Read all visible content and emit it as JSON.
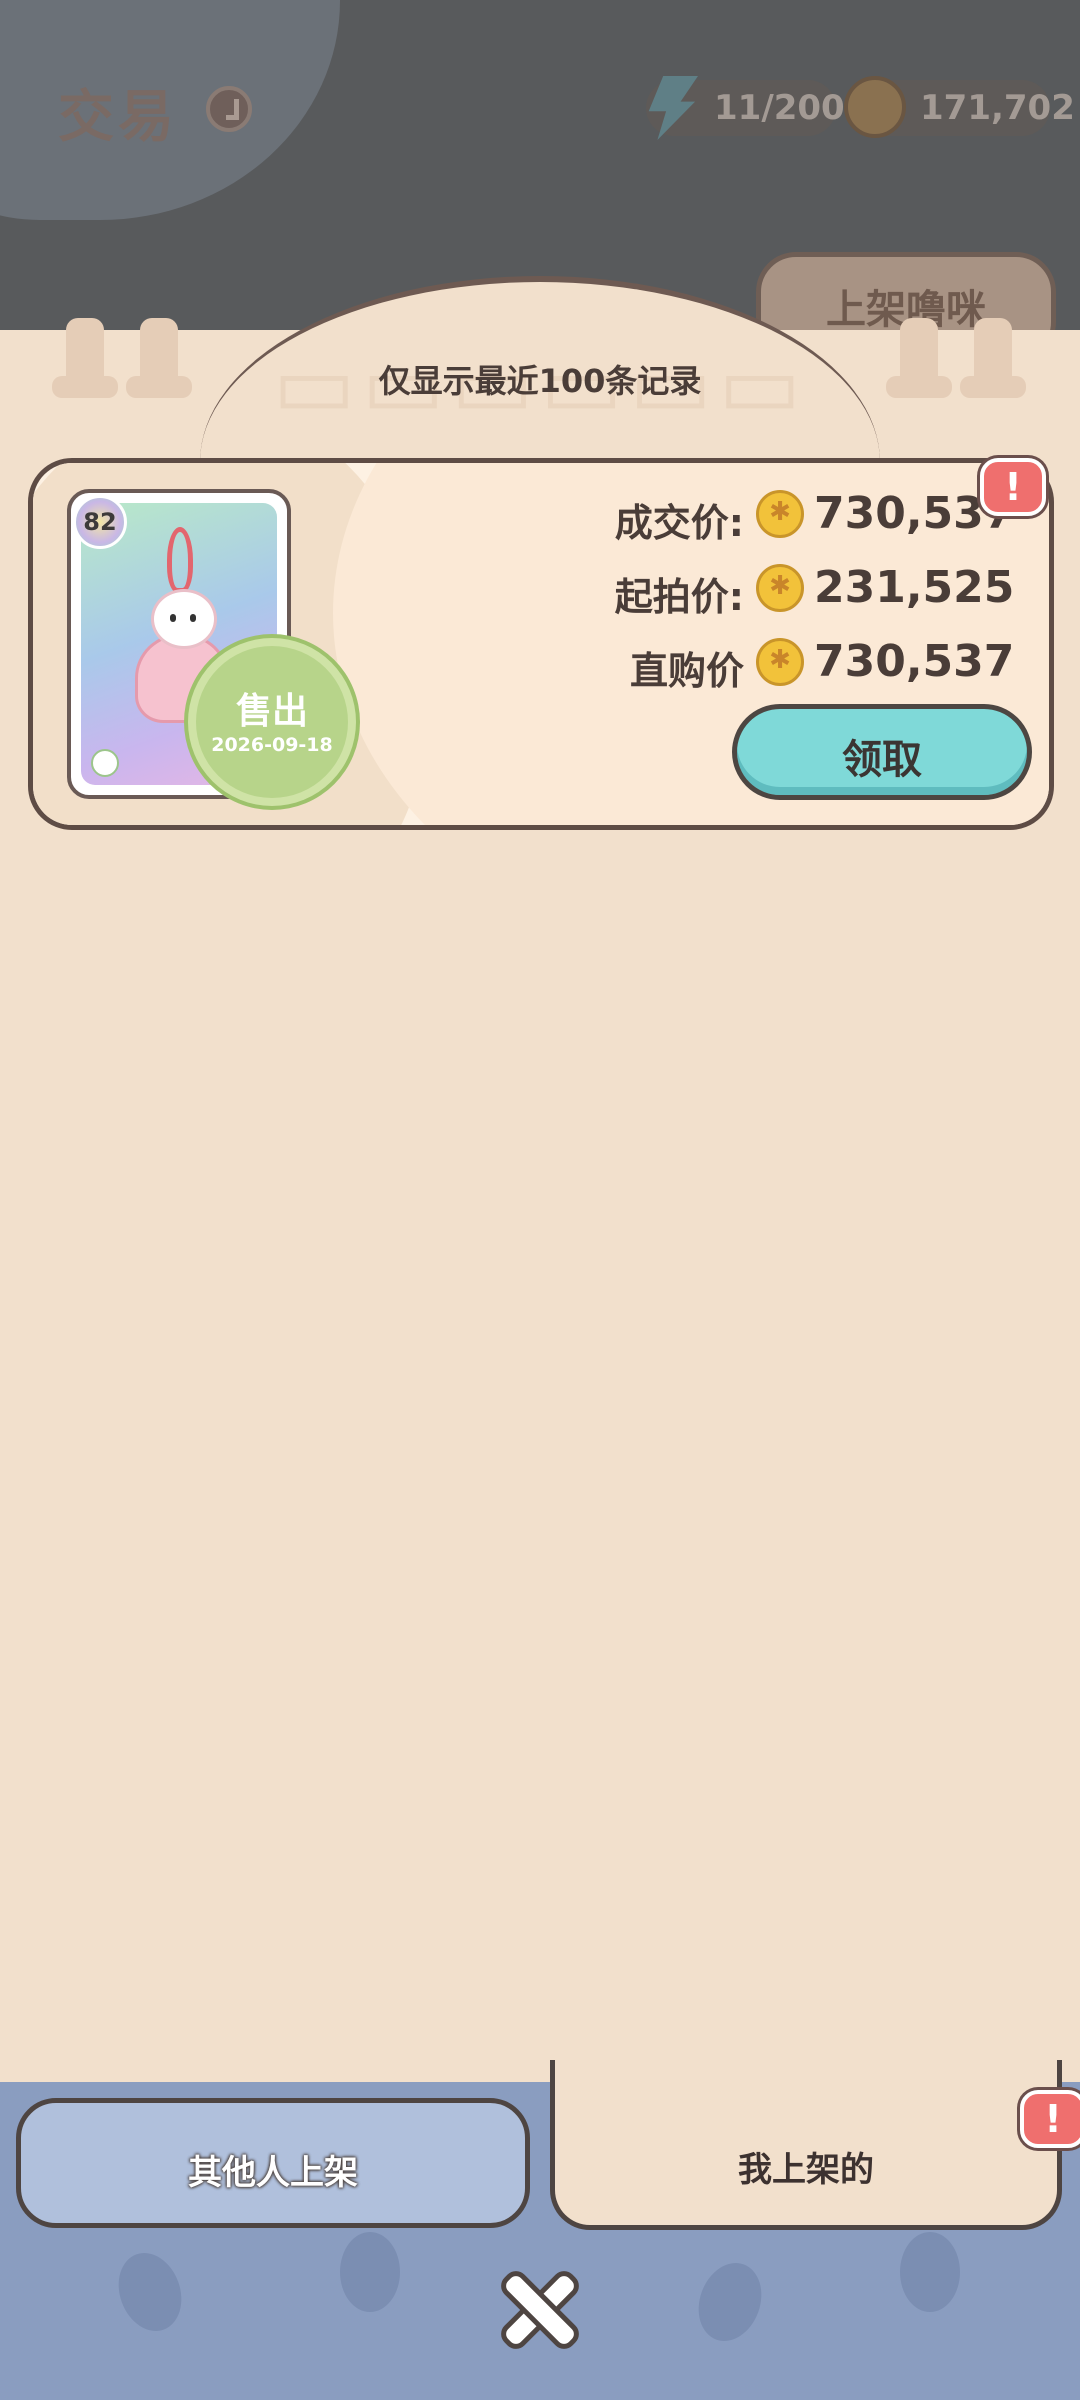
{
  "header": {
    "title": "交易",
    "energy": "11/200",
    "coins": "171,702",
    "list_button_label": "上架噜咪"
  },
  "panel": {
    "subtitle": "仅显示最近100条记录"
  },
  "record": {
    "level": "82",
    "stamp_text": "售出",
    "stamp_date": "2026-09-18",
    "deal_price_label": "成交价:",
    "deal_price": "730,537",
    "start_price_label": "起拍价:",
    "start_price": "231,525",
    "buyout_price_label": "直购价",
    "buyout_price": "730,537",
    "claim_label": "领取"
  },
  "tabs": {
    "others_label": "其他人上架",
    "mine_label": "我上架的"
  },
  "colors": {
    "claim_button": "#7fd9d8",
    "alert_badge": "#ef6f6e",
    "coin": "#f2c23a",
    "stamp": "#b7d48a"
  }
}
